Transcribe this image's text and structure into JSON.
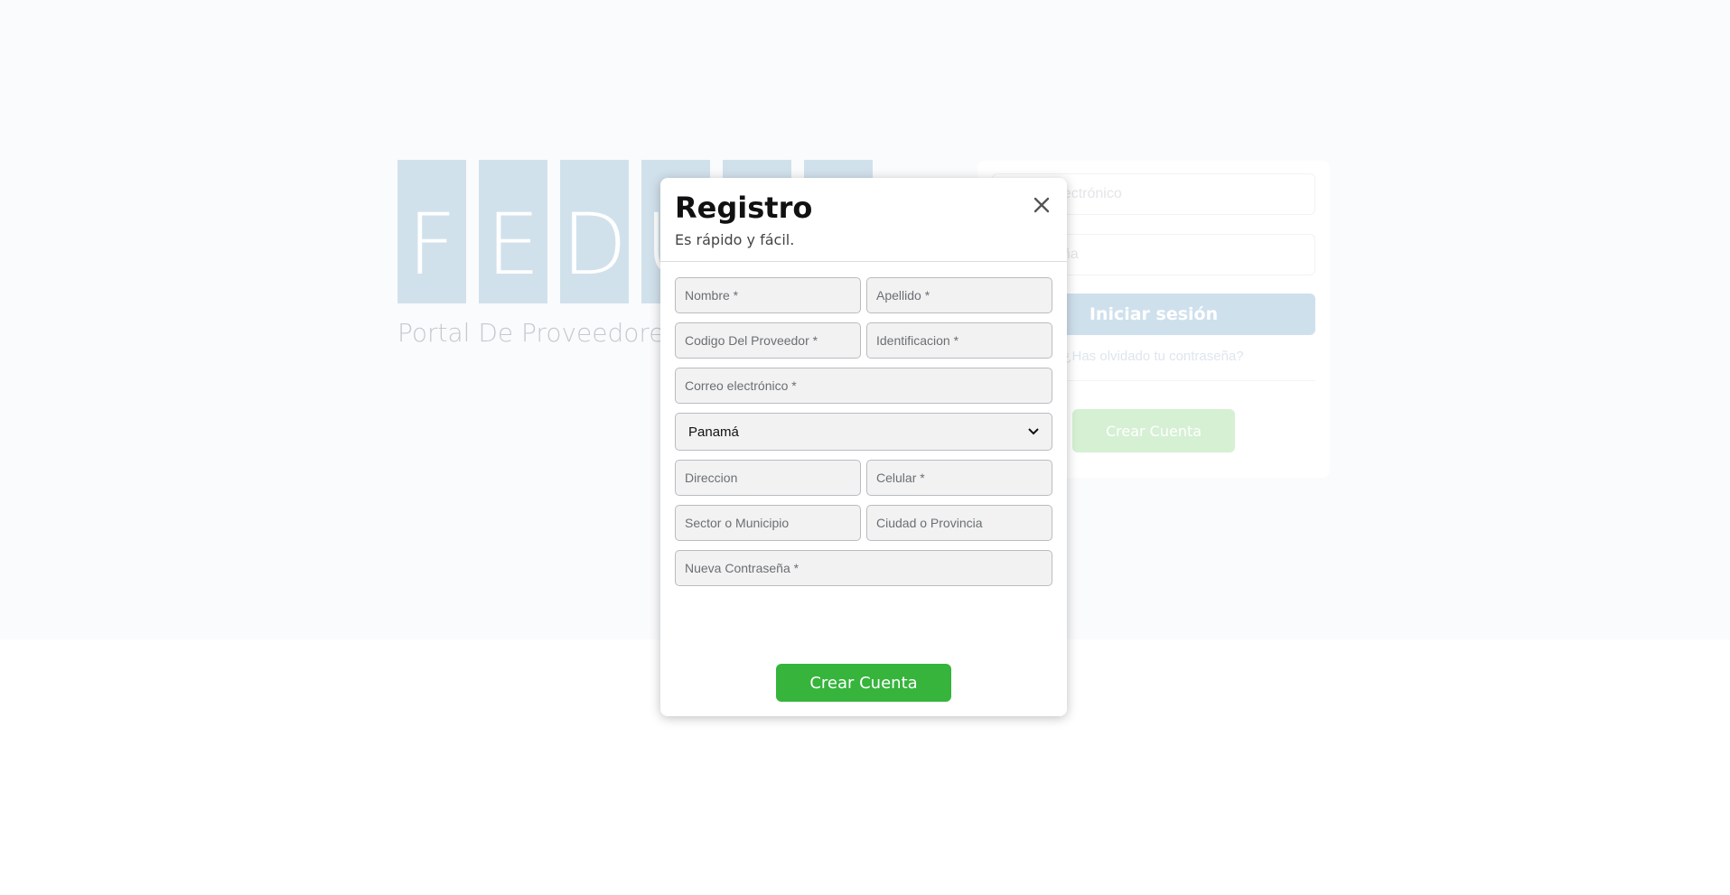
{
  "logo": {
    "letters": [
      "F",
      "E",
      "D",
      "U",
      "",
      ""
    ],
    "subtitle": "Portal De Proveedores"
  },
  "login": {
    "email_placeholder": "Correo electrónico",
    "password_placeholder": "Contraseña",
    "login_button": "Iniciar sesión",
    "forgot_link": "¿Has olvidado tu contraseña?",
    "create_account_button": "Crear Cuenta"
  },
  "modal": {
    "title": "Registro",
    "subtitle": "Es rápido y fácil.",
    "fields": {
      "nombre": "Nombre *",
      "apellido": "Apellido *",
      "codigo_proveedor": "Codigo Del Proveedor *",
      "identificacion": "Identificacion *",
      "correo": "Correo electrónico *",
      "direccion": "Direccion",
      "celular": "Celular *",
      "sector": "Sector o Municipio",
      "ciudad": "Ciudad o Provincia",
      "contrasena": "Nueva Contraseña *"
    },
    "country_select": {
      "selected": "Panamá"
    },
    "submit_button": "Crear Cuenta"
  },
  "colors": {
    "primary_green": "#36b43c",
    "logo_tile": "#d1e1ec"
  }
}
